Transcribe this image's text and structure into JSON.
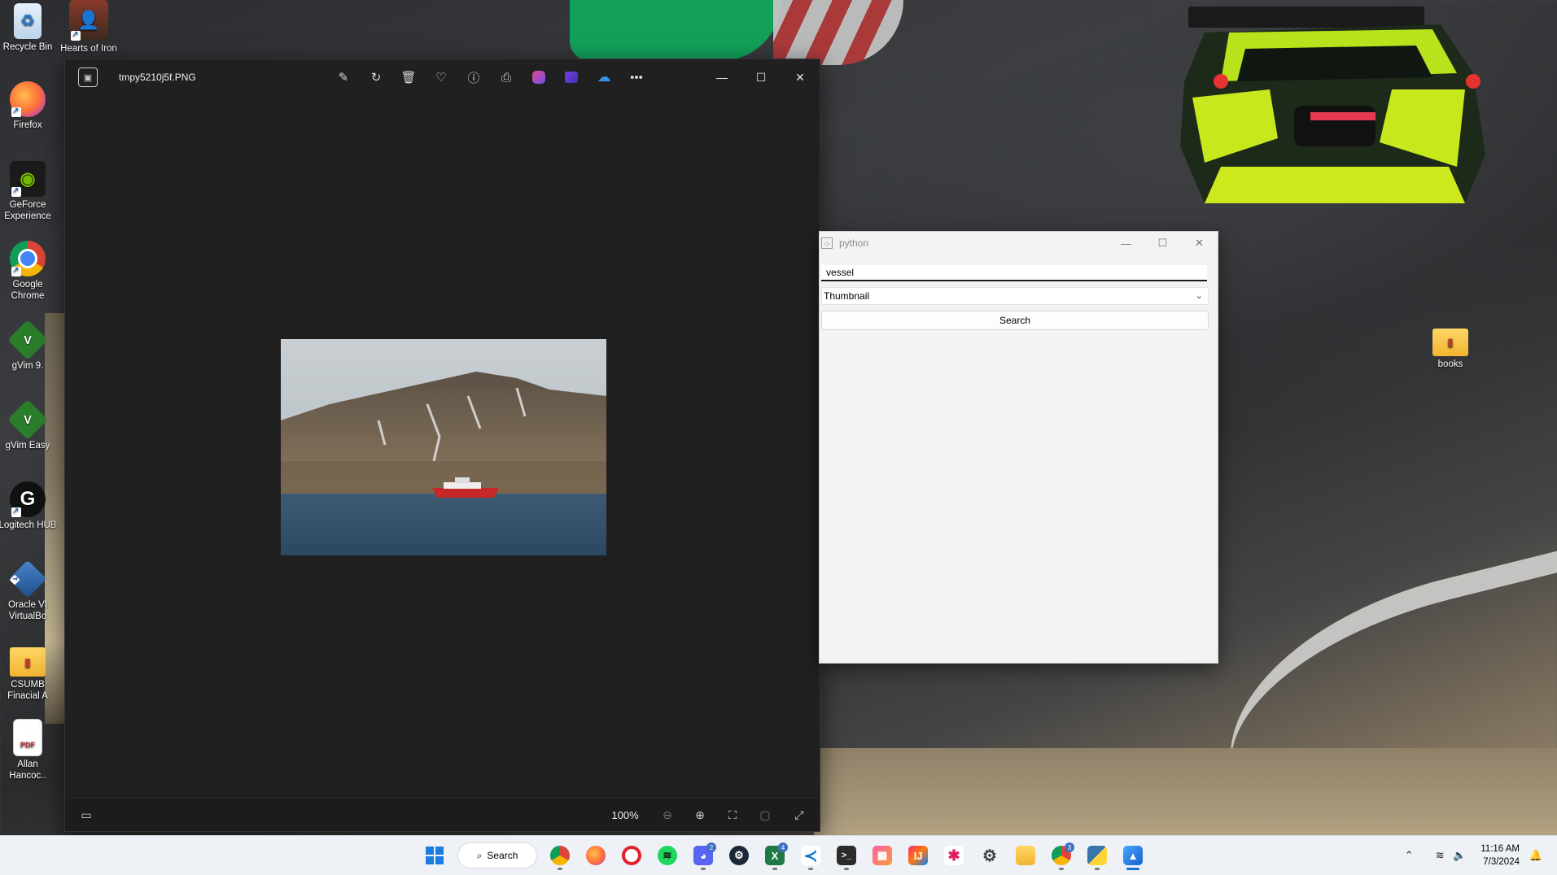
{
  "desktop": {
    "icons": [
      {
        "label": "Recycle Bin",
        "icon": "recycle-bin-icon"
      },
      {
        "label": "Hearts of Iron",
        "icon": "hearts-of-iron-icon"
      },
      {
        "label": "Firefox",
        "icon": "firefox-icon"
      },
      {
        "label": "GeForce Experience",
        "icon": "geforce-icon"
      },
      {
        "label": "Google Chrome",
        "icon": "chrome-icon"
      },
      {
        "label": "gVim 9.",
        "icon": "gvim-icon"
      },
      {
        "label": "gVim Easy",
        "icon": "gvim-icon"
      },
      {
        "label": "Logitech HUB",
        "icon": "logitech-icon"
      },
      {
        "label": "Oracle VI VirtualBo",
        "icon": "virtualbox-icon"
      },
      {
        "label": "CSUMB Finacial A",
        "icon": "folder-icon"
      },
      {
        "label": "Allan Hancoc..",
        "icon": "pdf-icon"
      },
      {
        "label": "books",
        "icon": "folder-icon"
      }
    ],
    "pdf_badge": "PDF"
  },
  "photos_window": {
    "filename": "tmpy5210j5f.PNG",
    "toolbar": [
      "edit-image-icon",
      "rotate-icon",
      "delete-icon",
      "favorite-icon",
      "info-icon",
      "print-icon",
      "copilot-icon",
      "clipchamp-icon",
      "onedrive-icon",
      "more-icon"
    ],
    "controls": {
      "minimize": "—",
      "maximize": "☐",
      "close": "✕"
    },
    "zoom": "100%"
  },
  "python_window": {
    "title": "python",
    "search_value": "vessel",
    "view_mode": "Thumbnail",
    "search_button": "Search"
  },
  "taskbar": {
    "search_label": "Search",
    "apps": [
      {
        "name": "chrome-icon",
        "badge": ""
      },
      {
        "name": "firefox-icon",
        "badge": ""
      },
      {
        "name": "opera-icon",
        "badge": ""
      },
      {
        "name": "spotify-icon",
        "badge": ""
      },
      {
        "name": "discord-icon",
        "badge": "2"
      },
      {
        "name": "steam-icon",
        "badge": ""
      },
      {
        "name": "excel-icon",
        "badge": "4"
      },
      {
        "name": "vscode-icon",
        "badge": ""
      },
      {
        "name": "terminal-icon",
        "badge": ""
      },
      {
        "name": "photos-icon",
        "badge": ""
      },
      {
        "name": "intellij-icon",
        "badge": ""
      },
      {
        "name": "slack-icon",
        "badge": ""
      },
      {
        "name": "settings-icon",
        "badge": ""
      },
      {
        "name": "file-explorer-icon",
        "badge": ""
      },
      {
        "name": "chrome-profile-icon",
        "badge": "3"
      },
      {
        "name": "python-icon",
        "badge": ""
      },
      {
        "name": "photos-app-icon",
        "badge": ""
      }
    ],
    "time": "11:16 AM",
    "date": "7/3/2024"
  },
  "colors": {
    "photos_bg": "#202020",
    "python_bg": "#f3f3f3",
    "taskbar_bg": "#eef1f6",
    "accent": "#1a6fd8",
    "boat_red": "#c62828"
  }
}
